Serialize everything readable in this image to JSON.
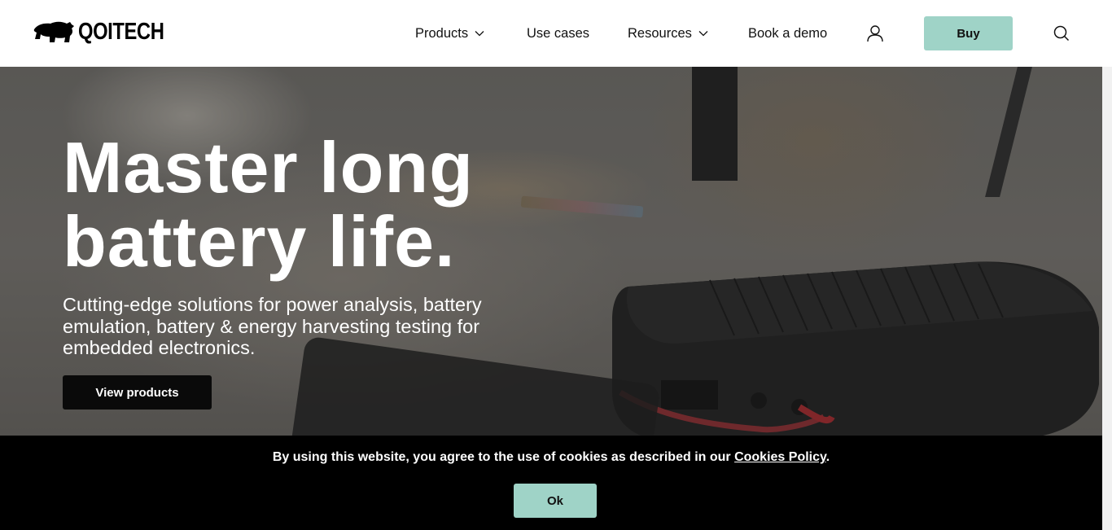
{
  "brand": {
    "name": "QOITECH",
    "logo_icon": "bear-icon"
  },
  "nav": {
    "items": [
      {
        "label": "Products",
        "has_dropdown": true
      },
      {
        "label": "Use cases",
        "has_dropdown": false
      },
      {
        "label": "Resources",
        "has_dropdown": true
      },
      {
        "label": "Book a demo",
        "has_dropdown": false
      }
    ],
    "account_icon": "user-icon",
    "buy_label": "Buy",
    "search_icon": "search-icon"
  },
  "hero": {
    "title_line1": "Master long",
    "title_line2": "battery life.",
    "subtitle": "Cutting-edge solutions for power analysis, battery emulation, battery & energy harvesting testing for embedded electronics.",
    "cta_label": "View products"
  },
  "cookie_banner": {
    "text_before": "By using this website, you agree to the use of cookies as described in our ",
    "link_text": "Cookies Policy",
    "text_after": ".",
    "ok_label": "Ok"
  },
  "colors": {
    "accent": "#9fd3c7",
    "header_bg": "#ffffff",
    "banner_bg": "#000000",
    "cta_bg": "#0a0a0a"
  }
}
